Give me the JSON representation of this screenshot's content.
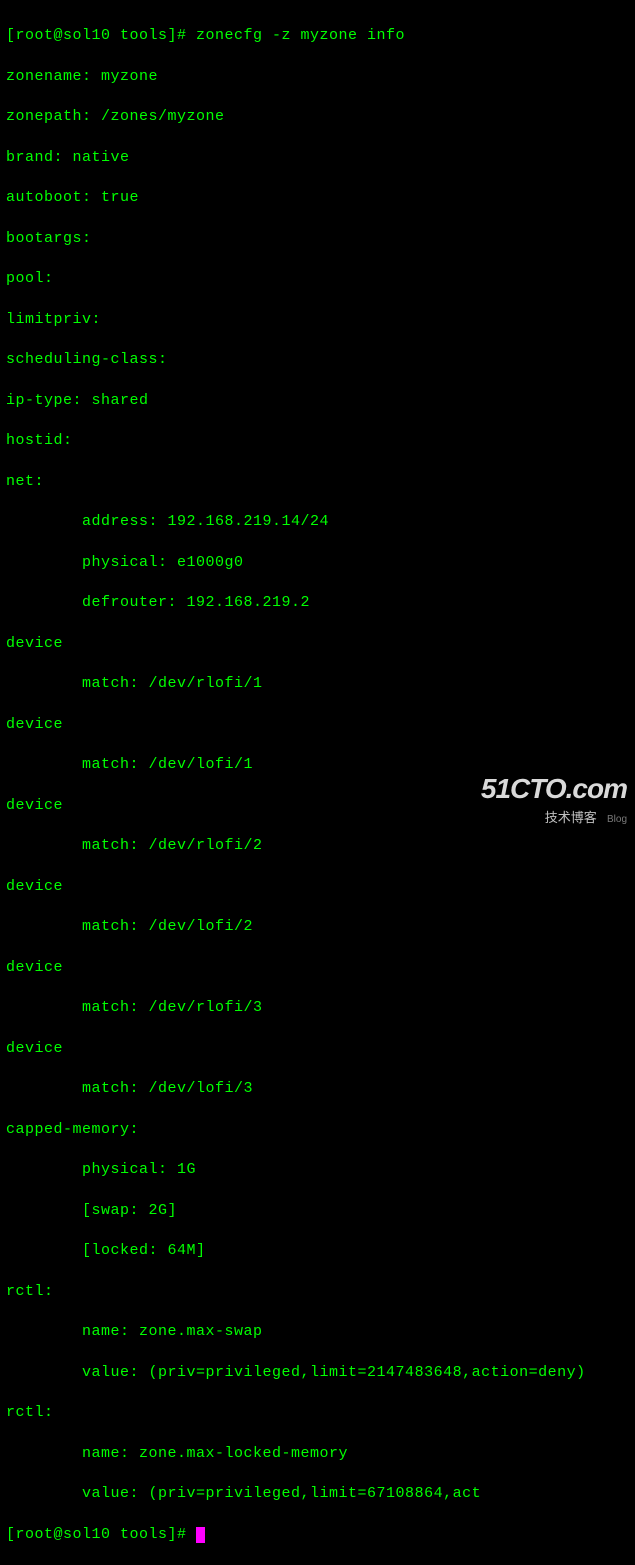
{
  "prompt1": "[root@sol10 tools]# ",
  "command": "zonecfg -z myzone info",
  "output": {
    "zonename": "zonename: myzone",
    "zonepath": "zonepath: /zones/myzone",
    "brand": "brand: native",
    "autoboot": "autoboot: true",
    "bootargs": "bootargs:",
    "pool": "pool:",
    "limitpriv": "limitpriv:",
    "scheduling_class": "scheduling-class:",
    "ip_type": "ip-type: shared",
    "hostid": "hostid:",
    "net_header": "net:",
    "net_address": "        address: 192.168.219.14/24",
    "net_physical": "        physical: e1000g0",
    "net_defrouter": "        defrouter: 192.168.219.2",
    "device1_h": "device",
    "device1_m": "        match: /dev/rlofi/1",
    "device2_h": "device",
    "device2_m": "        match: /dev/lofi/1",
    "device3_h": "device",
    "device3_m": "        match: /dev/rlofi/2",
    "device4_h": "device",
    "device4_m": "        match: /dev/lofi/2",
    "device5_h": "device",
    "device5_m": "        match: /dev/rlofi/3",
    "device6_h": "device",
    "device6_m": "        match: /dev/lofi/3",
    "capped_h": "capped-memory:",
    "capped_physical": "        physical: 1G",
    "capped_swap": "        [swap: 2G]",
    "capped_locked": "        [locked: 64M]",
    "rctl1_h": "rctl:",
    "rctl1_name": "        name: zone.max-swap",
    "rctl1_value": "        value: (priv=privileged,limit=2147483648,action=deny)",
    "rctl2_h": "rctl:",
    "rctl2_name": "        name: zone.max-locked-memory",
    "rctl2_value": "        value: (priv=privileged,limit=67108864,act"
  },
  "prompt2": "[root@sol10 tools]# ",
  "watermark": {
    "main": "51CTO.com",
    "sub": "技术博客",
    "blog": "Blog"
  }
}
